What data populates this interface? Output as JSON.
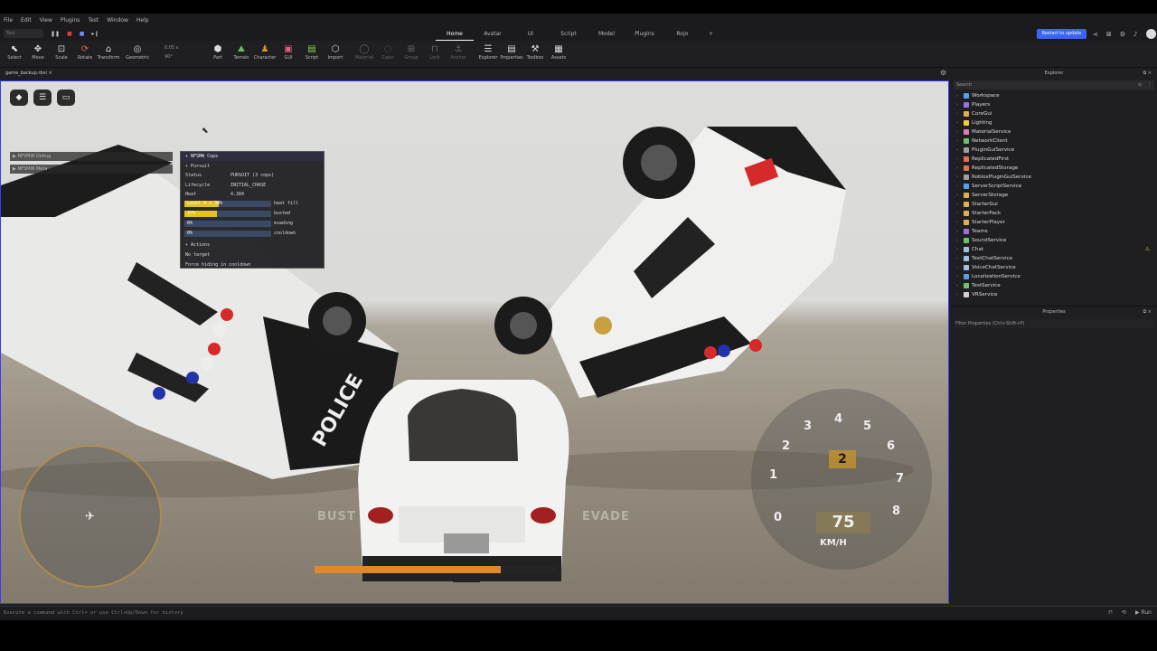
{
  "menu": [
    "File",
    "Edit",
    "View",
    "Plugins",
    "Test",
    "Window",
    "Help"
  ],
  "playmode": {
    "mode": "Test"
  },
  "tabs": [
    "Home",
    "Avatar",
    "UI",
    "Script",
    "Model",
    "Plugins",
    "Rojo"
  ],
  "active_tab": "Home",
  "restart_label": "Restart to update",
  "tools": {
    "select": "Select",
    "move": "Move",
    "scale": "Scale",
    "rotate": "Rotate",
    "transform": "Transform",
    "geometric": "Geometric",
    "part": "Part",
    "terrain": "Terrain",
    "character": "Character",
    "gui": "GUI",
    "script": "Script",
    "import": "Import",
    "material": "Material",
    "color": "Color",
    "group": "Group",
    "lock": "Lock",
    "anchor": "Anchor",
    "explorer": "Explorer",
    "properties": "Properties",
    "toolbox": "Toolbox",
    "assets": "Assets"
  },
  "snap": {
    "move": "0.05 s",
    "rotate": "90°"
  },
  "document_tab": "game_backup.rbxl",
  "side_tabs": [
    "NFSMW Debug",
    "NFSMW Meta"
  ],
  "cops_panel": {
    "title": "NFSMW Cops",
    "section": "Pursuit",
    "status_label": "Status",
    "status_value": "PURSUIT (3 cops)",
    "lifecycle_label": "Lifecycle",
    "lifecycle_value": "INITIAL_CHASE",
    "heat_label": "Heat",
    "heat_value": "4.384",
    "bars": [
      {
        "text": "Level 4 + 38%",
        "label": "heat fill",
        "fill": 0.4
      },
      {
        "text": "37%",
        "label": "busted",
        "fill": 0.37
      },
      {
        "text": "0%",
        "label": "evading",
        "fill": 0
      },
      {
        "text": "0%",
        "label": "cooldown",
        "fill": 0
      }
    ],
    "actions_label": "Actions",
    "action_1": "No target",
    "action_2": "Force hiding in cooldown"
  },
  "hud": {
    "busted_text": "BUST",
    "evade_text": "EVADE",
    "speed": "75",
    "gear": "2",
    "unit": "KM/H",
    "dial_numbers": [
      "0",
      "1",
      "2",
      "3",
      "4",
      "5",
      "6",
      "7",
      "8"
    ],
    "heat_fill": 0.77
  },
  "explorer": {
    "title": "Explorer",
    "search_placeholder": "Search",
    "items": [
      {
        "name": "Workspace",
        "color": "#5aa0e6"
      },
      {
        "name": "Players",
        "color": "#9a6fe0"
      },
      {
        "name": "CoreGui",
        "color": "#e0b050"
      },
      {
        "name": "Lighting",
        "color": "#f0d040"
      },
      {
        "name": "MaterialService",
        "color": "#d080c0"
      },
      {
        "name": "NetworkClient",
        "color": "#70c070"
      },
      {
        "name": "PluginGuiService",
        "color": "#a0a0a0"
      },
      {
        "name": "ReplicatedFirst",
        "color": "#e07050"
      },
      {
        "name": "ReplicatedStorage",
        "color": "#e07050"
      },
      {
        "name": "RobloxPluginGuiService",
        "color": "#a0a0a0"
      },
      {
        "name": "ServerScriptService",
        "color": "#5aa0e6"
      },
      {
        "name": "ServerStorage",
        "color": "#e0b050"
      },
      {
        "name": "StarterGui",
        "color": "#e0b050"
      },
      {
        "name": "StarterPack",
        "color": "#e0b050"
      },
      {
        "name": "StarterPlayer",
        "color": "#e0b050"
      },
      {
        "name": "Teams",
        "color": "#9a6fe0"
      },
      {
        "name": "SoundService",
        "color": "#70c070"
      },
      {
        "name": "Chat",
        "color": "#a0c0e0"
      },
      {
        "name": "TextChatService",
        "color": "#a0c0e0"
      },
      {
        "name": "VoiceChatService",
        "color": "#a0c0e0"
      },
      {
        "name": "LocalizationService",
        "color": "#5aa0e6"
      },
      {
        "name": "TestService",
        "color": "#70c070"
      },
      {
        "name": "VRService",
        "color": "#d0d0d0"
      }
    ]
  },
  "properties": {
    "title": "Properties",
    "filter_placeholder": "Filter Properties (Ctrl+Shift+P)"
  },
  "command_bar": {
    "placeholder": "Execute a command with Ctrl+ or use Ctrl+Up/Down for history",
    "run_label": "Run"
  },
  "colors": {
    "accent": "#3b64f5",
    "heat": "#e6c21c",
    "selection": "#3a3df0"
  }
}
